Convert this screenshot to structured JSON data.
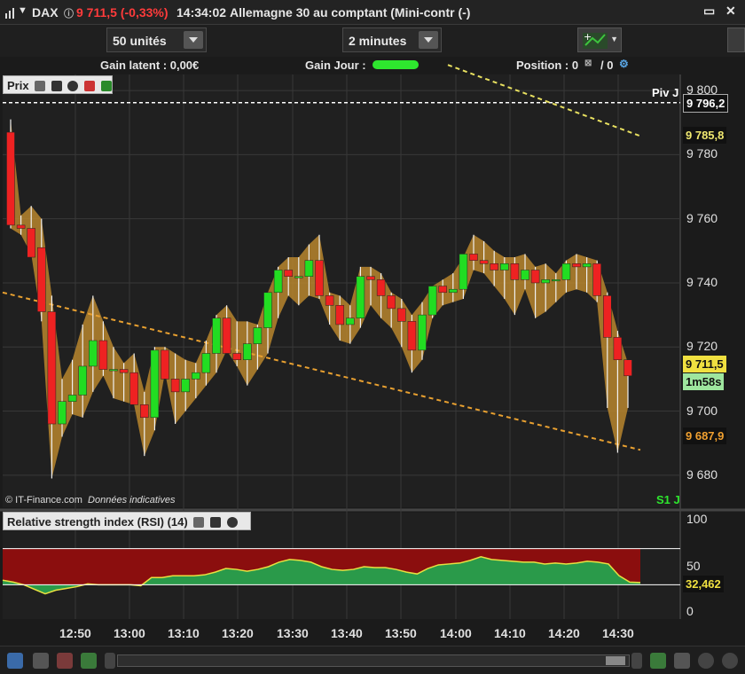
{
  "titlebar": {
    "instrument": "DAX",
    "price_change": "9 711,5 (-0,33%)",
    "time": "14:34:02",
    "description": "Allemagne 30 au comptant (Mini-contr (-)"
  },
  "toolbar": {
    "quantity": "50 unités",
    "timeframe": "2 minutes"
  },
  "infobar": {
    "gain_latent": "Gain latent : 0,00€",
    "gain_jour": "Gain Jour :",
    "position_label": "Position : 0",
    "position_sep": "/ 0"
  },
  "price_panel": {
    "label": "Prix",
    "copyright": "© IT-Finance.com",
    "disclaimer": "Données indicatives",
    "piv_label": "Piv J",
    "s1_label": "S1 J"
  },
  "rsi_panel": {
    "label": "Relative strength index (RSI) (14)",
    "axis_labels": [
      "100",
      "50",
      "0"
    ],
    "value_label": "32,462"
  },
  "price_boxes": {
    "piv": "9 796,2",
    "trend_upper": "9 785,8",
    "current": "9 711,5",
    "countdown": "1m58s",
    "trend_lower": "9 687,9"
  },
  "colors": {
    "up": "#22dd22",
    "down": "#ee2222",
    "band": "#b8862e",
    "trend": "#e8a030",
    "trend_upper": "#e8e060",
    "rsi_fill": "#2a9a4a",
    "rsi_over": "#8b0e0e",
    "rsi_line": "#e8e040"
  },
  "chart_data": {
    "type": "candlestick",
    "title": "DAX 2 minutes",
    "ylim": [
      9670,
      9805
    ],
    "y_ticks": [
      "9 680",
      "9 700",
      "9 720",
      "9 740",
      "9 760",
      "9 780",
      "9 800"
    ],
    "y_tick_values": [
      9680,
      9700,
      9720,
      9740,
      9760,
      9780,
      9800
    ],
    "x_ticks": [
      "12:50",
      "13:00",
      "13:10",
      "13:20",
      "13:30",
      "13:40",
      "13:50",
      "14:00",
      "14:10",
      "14:20",
      "14:30"
    ],
    "candles": [
      [
        9787,
        9791,
        9757,
        9758
      ],
      [
        9758,
        9761,
        9755,
        9757
      ],
      [
        9757,
        9764,
        9749,
        9748
      ],
      [
        9751,
        9760,
        9728,
        9731
      ],
      [
        9731,
        9736,
        9679,
        9696
      ],
      [
        9696,
        9710,
        9692,
        9703
      ],
      [
        9703,
        9716,
        9699,
        9705
      ],
      [
        9705,
        9727,
        9698,
        9714
      ],
      [
        9714,
        9736,
        9706,
        9722
      ],
      [
        9722,
        9728,
        9711,
        9713
      ],
      [
        9713,
        9720,
        9704,
        9713
      ],
      [
        9713,
        9715,
        9703,
        9712
      ],
      [
        9712,
        9718,
        9702,
        9702
      ],
      [
        9702,
        9706,
        9686,
        9698
      ],
      [
        9698,
        9720,
        9694,
        9719
      ],
      [
        9719,
        9720,
        9712,
        9710
      ],
      [
        9710,
        9718,
        9696,
        9706
      ],
      [
        9706,
        9716,
        9700,
        9710
      ],
      [
        9710,
        9715,
        9704,
        9712
      ],
      [
        9712,
        9722,
        9708,
        9718
      ],
      [
        9718,
        9730,
        9712,
        9729
      ],
      [
        9729,
        9733,
        9719,
        9718
      ],
      [
        9718,
        9728,
        9714,
        9716
      ],
      [
        9716,
        9728,
        9708,
        9721
      ],
      [
        9721,
        9727,
        9713,
        9726
      ],
      [
        9726,
        9737,
        9718,
        9737
      ],
      [
        9737,
        9745,
        9729,
        9744
      ],
      [
        9744,
        9748,
        9736,
        9742
      ],
      [
        9742,
        9748,
        9733,
        9742
      ],
      [
        9742,
        9752,
        9736,
        9747
      ],
      [
        9747,
        9755,
        9735,
        9736
      ],
      [
        9736,
        9737,
        9727,
        9733
      ],
      [
        9733,
        9736,
        9722,
        9727
      ],
      [
        9727,
        9733,
        9721,
        9729
      ],
      [
        9729,
        9745,
        9726,
        9742
      ],
      [
        9742,
        9745,
        9733,
        9741
      ],
      [
        9741,
        9743,
        9729,
        9736
      ],
      [
        9736,
        9737,
        9726,
        9732
      ],
      [
        9732,
        9735,
        9720,
        9728
      ],
      [
        9728,
        9730,
        9712,
        9719
      ],
      [
        9719,
        9734,
        9716,
        9730
      ],
      [
        9730,
        9739,
        9729,
        9739
      ],
      [
        9739,
        9741,
        9733,
        9737
      ],
      [
        9737,
        9743,
        9734,
        9738
      ],
      [
        9738,
        9748,
        9735,
        9749
      ],
      [
        9749,
        9755,
        9744,
        9747
      ],
      [
        9747,
        9753,
        9743,
        9746
      ],
      [
        9746,
        9750,
        9739,
        9744
      ],
      [
        9744,
        9748,
        9735,
        9746
      ],
      [
        9746,
        9748,
        9730,
        9741
      ],
      [
        9741,
        9749,
        9738,
        9744
      ],
      [
        9744,
        9745,
        9729,
        9740
      ],
      [
        9740,
        9746,
        9731,
        9741
      ],
      [
        9741,
        9743,
        9734,
        9741
      ],
      [
        9741,
        9747,
        9737,
        9746
      ],
      [
        9746,
        9749,
        9738,
        9745
      ],
      [
        9745,
        9748,
        9737,
        9746
      ],
      [
        9746,
        9747,
        9734,
        9736
      ],
      [
        9736,
        9737,
        9701,
        9723
      ],
      [
        9723,
        9725,
        9687,
        9716
      ],
      [
        9716,
        9715,
        9701,
        9711
      ]
    ],
    "candle_fields": [
      "open",
      "high",
      "low",
      "close"
    ],
    "piv_level": 9796.2,
    "trend_lower": {
      "start": 9737,
      "end": 9687.9
    },
    "trend_upper": {
      "start": 9808,
      "end": 9785.8
    },
    "rsi": {
      "ylim": [
        0,
        100
      ],
      "overbought": 70,
      "oversold": 30,
      "values": [
        35,
        33,
        30,
        25,
        20,
        24,
        26,
        28,
        31,
        30,
        30,
        30,
        30,
        29,
        38,
        38,
        40,
        40,
        40,
        41,
        44,
        48,
        47,
        45,
        47,
        50,
        55,
        58,
        57,
        55,
        50,
        47,
        46,
        47,
        50,
        49,
        49,
        47,
        44,
        42,
        48,
        52,
        53,
        54,
        57,
        61,
        58,
        57,
        56,
        55,
        55,
        53,
        54,
        53,
        54,
        56,
        55,
        53,
        40,
        33,
        32.5
      ]
    }
  }
}
